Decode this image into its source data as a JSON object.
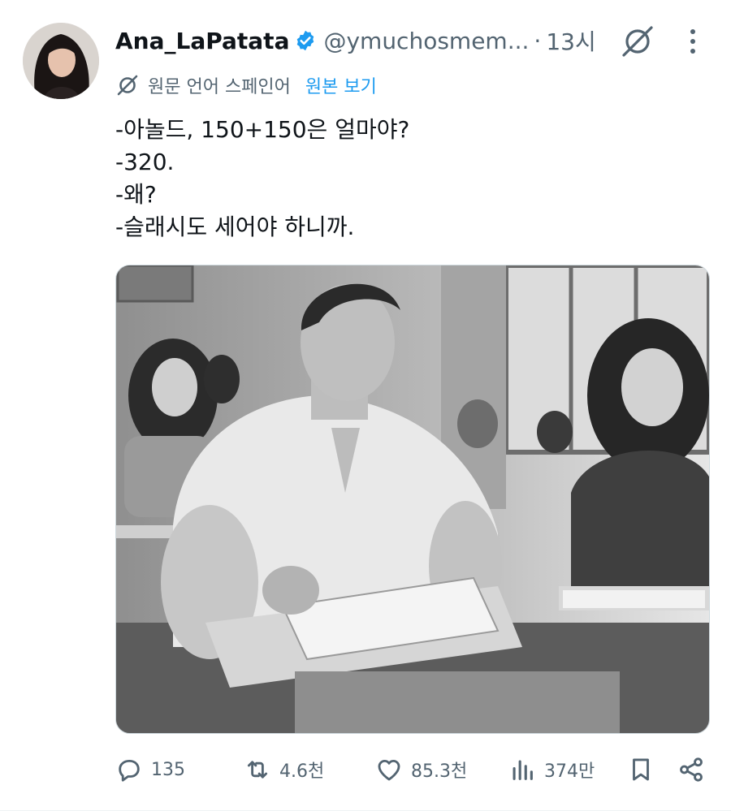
{
  "tweet": {
    "display_name": "Ana_LaPatata",
    "handle": "@ymuchosmem...",
    "separator": "·",
    "time": "13시",
    "translation": {
      "language_label": "원문 언어 스페인어",
      "show_original": "원본 보기"
    },
    "lines": [
      "-아놀드, 150+150은 얼마야?",
      "-320.",
      "-왜?",
      "-슬래시도 세어야 하니까."
    ]
  },
  "actions": {
    "replies": "135",
    "reposts": "4.6천",
    "likes": "85.3천",
    "views": "374만"
  },
  "colors": {
    "verified": "#1d9bf0",
    "link": "#1d9bf0",
    "muted": "#536471",
    "text": "#0f1419"
  },
  "icons": [
    "grok-icon",
    "more-icon",
    "translate-icon",
    "reply-icon",
    "repost-icon",
    "like-icon",
    "views-icon",
    "bookmark-icon",
    "share-icon",
    "verified-icon"
  ]
}
